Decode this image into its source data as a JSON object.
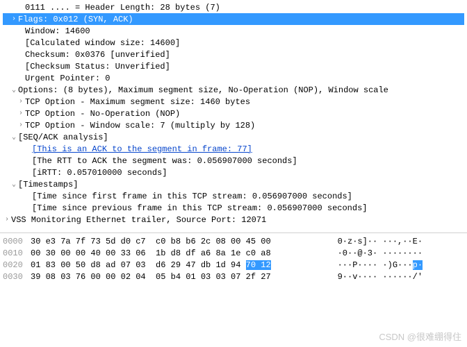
{
  "tree": {
    "header_len": "0111 .... = Header Length: 28 bytes (7)",
    "flags": "Flags: 0x012 (SYN, ACK)",
    "window": "Window: 14600",
    "calc_win": "[Calculated window size: 14600]",
    "checksum": "Checksum: 0x0376 [unverified]",
    "checksum_status": "[Checksum Status: Unverified]",
    "urgent": "Urgent Pointer: 0",
    "options": "Options: (8 bytes), Maximum segment size, No-Operation (NOP), Window scale",
    "opt_mss": "TCP Option - Maximum segment size: 1460 bytes",
    "opt_nop": "TCP Option - No-Operation (NOP)",
    "opt_ws": "TCP Option - Window scale: 7 (multiply by 128)",
    "seqack": "[SEQ/ACK analysis]",
    "seqack_ack77": "[This is an ACK to the segment in frame: 77]",
    "seqack_rtt": "[The RTT to ACK the segment was: 0.056907000 seconds]",
    "seqack_irtt": "[iRTT: 0.057010000 seconds]",
    "timestamps": "[Timestamps]",
    "ts_first": "[Time since first frame in this TCP stream: 0.056907000 seconds]",
    "ts_prev": "[Time since previous frame in this TCP stream: 0.056907000 seconds]",
    "vss": "VSS Monitoring Ethernet trailer, Source Port: 12071"
  },
  "glyph": {
    "right": "›",
    "down": "⌄"
  },
  "hex": {
    "r0": {
      "off": "0000",
      "b1": "30 e3 7a 7f 73 5d d0 c7 ",
      "b2": " c0 b8 b6 2c 08 00 45 00",
      "ascii": "   0·z·s]·· ···,··E·"
    },
    "r1": {
      "off": "0010",
      "b1": "00 30 00 00 40 00 33 06 ",
      "b2": " 1b d8 df a6 8a 1e c0 a8",
      "ascii": "   ·0··@·3· ········"
    },
    "r2": {
      "off": "0020",
      "b1": "01 83 00 50 d8 ad 07 03 ",
      "b2a": " d6 29 47 db 1d 94 ",
      "b2b": "70 12",
      "asc_a": "   ···P···· ·)G···",
      "asc_b": "p·"
    },
    "r3": {
      "off": "0030",
      "b1": "39 08 03 76 00 00 02 04 ",
      "b2": " 05 b4 01 03 03 07 2f 27",
      "ascii": "   9··v···· ······/'"
    }
  },
  "watermark": "CSDN @很难绷得住"
}
